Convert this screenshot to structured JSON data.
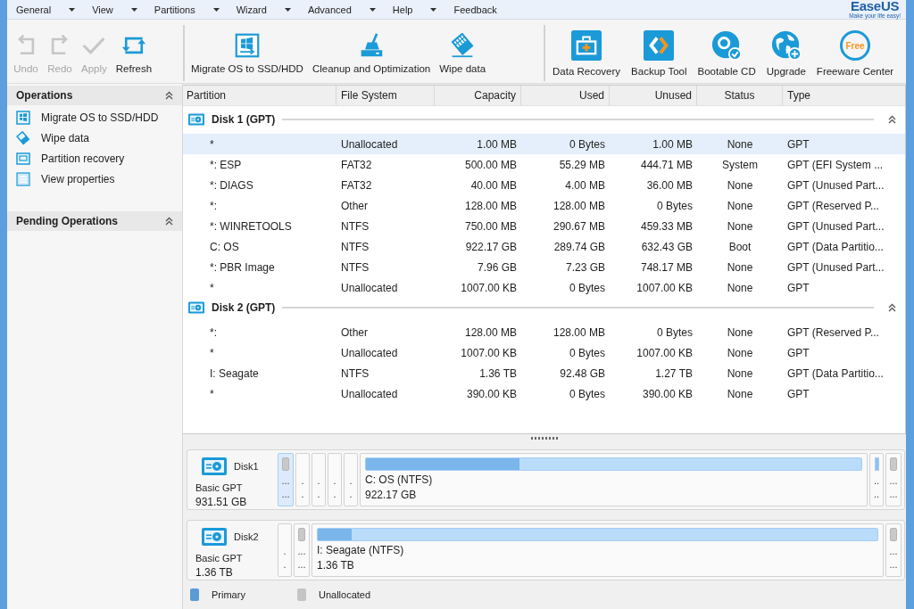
{
  "menu": [
    {
      "label": "General",
      "dropdown": true
    },
    {
      "label": "View",
      "dropdown": true
    },
    {
      "label": "Partitions",
      "dropdown": true
    },
    {
      "label": "Wizard",
      "dropdown": true
    },
    {
      "label": "Advanced",
      "dropdown": true
    },
    {
      "label": "Help",
      "dropdown": true
    },
    {
      "label": "Feedback",
      "dropdown": false
    }
  ],
  "logo": {
    "name": "EaseUS",
    "tagline": "Make your life easy!"
  },
  "toolbar": {
    "groups": [
      {
        "items": [
          {
            "label": "Undo",
            "disabled": true
          },
          {
            "label": "Redo",
            "disabled": true
          },
          {
            "label": "Apply",
            "disabled": true
          },
          {
            "label": "Refresh",
            "disabled": false
          }
        ]
      },
      {
        "items": [
          {
            "label": "Migrate OS to SSD/HDD",
            "disabled": false
          },
          {
            "label": "Cleanup and Optimization",
            "disabled": false
          },
          {
            "label": "Wipe data",
            "disabled": false
          }
        ]
      },
      {
        "items": [
          {
            "label": "Data Recovery",
            "disabled": false
          },
          {
            "label": "Backup Tool",
            "disabled": false
          },
          {
            "label": "Bootable CD",
            "disabled": false
          },
          {
            "label": "Upgrade",
            "disabled": false
          },
          {
            "label": "Freeware Center",
            "disabled": false,
            "badge": "Free"
          }
        ]
      }
    ]
  },
  "sidebar": {
    "sections": [
      {
        "title": "Operations",
        "expanded": true,
        "items": [
          {
            "label": "Migrate OS to SSD/HDD"
          },
          {
            "label": "Wipe data"
          },
          {
            "label": "Partition recovery"
          },
          {
            "label": "View properties"
          }
        ]
      },
      {
        "title": "Pending Operations",
        "expanded": true
      }
    ]
  },
  "table": {
    "columns": [
      "Partition",
      "File System",
      "Capacity",
      "Used",
      "Unused",
      "Status",
      "Type"
    ],
    "disks": [
      {
        "title": "Disk 1 (GPT)",
        "expanded": true,
        "rows": [
          {
            "cells": [
              "*",
              "Unallocated",
              "1.00 MB",
              "0 Bytes",
              "1.00 MB",
              "None",
              "GPT"
            ],
            "selected": true
          },
          {
            "cells": [
              "*: ESP",
              "FAT32",
              "500.00 MB",
              "55.29 MB",
              "444.71 MB",
              "System",
              "GPT (EFI System ..."
            ],
            "selected": false
          },
          {
            "cells": [
              "*: DIAGS",
              "FAT32",
              "40.00 MB",
              "4.00 MB",
              "36.00 MB",
              "None",
              "GPT (Unused Part..."
            ],
            "selected": false
          },
          {
            "cells": [
              "*:",
              "Other",
              "128.00 MB",
              "128.00 MB",
              "0 Bytes",
              "None",
              "GPT (Reserved P..."
            ],
            "selected": false
          },
          {
            "cells": [
              "*: WINRETOOLS",
              "NTFS",
              "750.00 MB",
              "290.67 MB",
              "459.33 MB",
              "None",
              "GPT (Unused Part..."
            ],
            "selected": false
          },
          {
            "cells": [
              "C: OS",
              "NTFS",
              "922.17 GB",
              "289.74 GB",
              "632.43 GB",
              "Boot",
              "GPT (Data Partitio..."
            ],
            "selected": false
          },
          {
            "cells": [
              "*: PBR Image",
              "NTFS",
              "7.96 GB",
              "7.23 GB",
              "748.17 MB",
              "None",
              "GPT (Unused Part..."
            ],
            "selected": false
          },
          {
            "cells": [
              "*",
              "Unallocated",
              "1007.00 KB",
              "0 Bytes",
              "1007.00 KB",
              "None",
              "GPT"
            ],
            "selected": false
          }
        ]
      },
      {
        "title": "Disk 2 (GPT)",
        "expanded": true,
        "rows": [
          {
            "cells": [
              "*:",
              "Other",
              "128.00 MB",
              "128.00 MB",
              "0 Bytes",
              "None",
              "GPT (Reserved P..."
            ],
            "selected": false
          },
          {
            "cells": [
              "*",
              "Unallocated",
              "1007.00 KB",
              "0 Bytes",
              "1007.00 KB",
              "None",
              "GPT"
            ],
            "selected": false
          },
          {
            "cells": [
              "I: Seagate",
              "NTFS",
              "1.36 TB",
              "92.48 GB",
              "1.27 TB",
              "None",
              "GPT (Data Partitio..."
            ],
            "selected": false
          },
          {
            "cells": [
              "*",
              "Unallocated",
              "390.00 KB",
              "0 Bytes",
              "390.00 KB",
              "None",
              "GPT"
            ],
            "selected": false
          }
        ]
      }
    ]
  },
  "disk_map": {
    "disks": [
      {
        "name": "Disk1",
        "type": "Basic GPT",
        "size": "931.51 GB",
        "partitions": [
          {
            "kind": "unallocated",
            "label": "...",
            "size": "...",
            "selected": true
          },
          {
            "kind": "narrow",
            "label": ".",
            "size": ".",
            "selected": false
          },
          {
            "kind": "narrow",
            "label": ".",
            "size": ".",
            "selected": false
          },
          {
            "kind": "narrow",
            "label": ".",
            "size": ".",
            "selected": false
          },
          {
            "kind": "narrow",
            "label": ".",
            "size": ".",
            "selected": false
          },
          {
            "kind": "main",
            "label": "C: OS (NTFS)",
            "size": "922.17 GB",
            "level": 0.31,
            "selected": false
          },
          {
            "kind": "narrow_used",
            "label": "..",
            "size": "..",
            "selected": false
          },
          {
            "kind": "unallocated",
            "label": "...",
            "size": "...",
            "selected": false
          }
        ]
      },
      {
        "name": "Disk2",
        "type": "Basic GPT",
        "size": "1.36 TB",
        "partitions": [
          {
            "kind": "narrow",
            "label": ".",
            "size": ".",
            "selected": false
          },
          {
            "kind": "unallocated",
            "label": "...",
            "size": "...",
            "selected": false
          },
          {
            "kind": "main",
            "label": "I: Seagate (NTFS)",
            "size": "1.36 TB",
            "level": 0.06,
            "selected": false
          },
          {
            "kind": "unallocated",
            "label": "...",
            "size": "...",
            "selected": false
          }
        ]
      }
    ]
  },
  "legend": [
    {
      "label": "Primary",
      "color": "#5b9bd5"
    },
    {
      "label": "Unallocated",
      "color": "#c4c4c4"
    }
  ]
}
